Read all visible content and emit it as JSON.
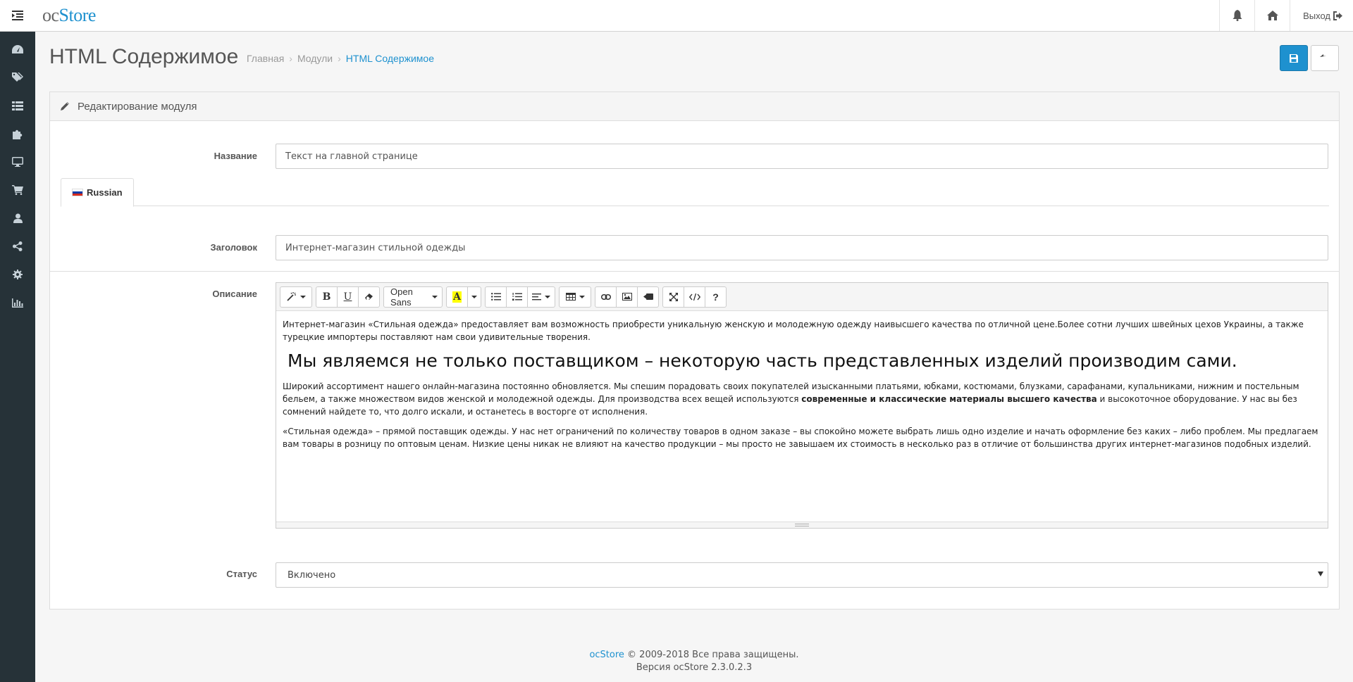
{
  "header": {
    "logo_oc": "oc",
    "logo_store": "Store",
    "logout_label": "Выход"
  },
  "page": {
    "title": "HTML Содержимое",
    "breadcrumb": [
      "Главная",
      "Модули",
      "HTML Содержимое"
    ]
  },
  "panel": {
    "heading": "Редактирование модуля"
  },
  "form": {
    "name_label": "Название",
    "name_value": "Текст на главной странице",
    "tab_label": "Russian",
    "title_label": "Заголовок",
    "title_value": "Интернет-магазин стильной одежды",
    "description_label": "Описание",
    "status_label": "Статус",
    "status_value": "Включено"
  },
  "editor": {
    "font_name": "Open Sans",
    "p1": "Интернет-магазин «Стильная одежда» предоставляет вам возможность приобрести уникальную женскую и молодежную одежду наивысшего качества по отличной цене.Более сотни лучших швейных цехов Украины, а также турецкие импортеры поставляют нам свои удивительные творения.",
    "heading": "Мы являемся не только поставщиком – некоторую часть представленных изделий производим сами.",
    "p2_start": "Широкий ассортимент нашего онлайн-магазина постоянно обновляется. Мы спешим порадовать своих покупателей изысканными платьями, юбками, костюмами, блузками, сарафанами, купальниками, нижним и постельным бельем, а также множеством видов женской и молодежной одежды. Для производства всех вещей используются ",
    "p2_bold": "современные и классические материалы высшего качества",
    "p2_end": " и высокоточное оборудование. У нас вы без сомнений найдете то, что долго искали, и останетесь в восторге от исполнения.",
    "p3": "«Стильная одежда» – прямой поставщик одежды. У нас нет ограничений по количеству товаров в одном заказе – вы спокойно можете выбрать лишь одно изделие и начать оформление без каких – либо проблем. Мы предлагаем вам товары в розницу по оптовым ценам. Низкие цены никак не влияют на качество продукции – мы просто не завышаем их стоимость в несколько раз в отличие от большинства других интернет-магазинов подобных изделий."
  },
  "footer": {
    "link": "ocStore",
    "copyright": " © 2009-2018 Все права защищены.",
    "version": "Версия ocStore 2.3.0.2.3"
  },
  "colors": {
    "accent": "#1e91cf",
    "sidebar": "#263238"
  }
}
